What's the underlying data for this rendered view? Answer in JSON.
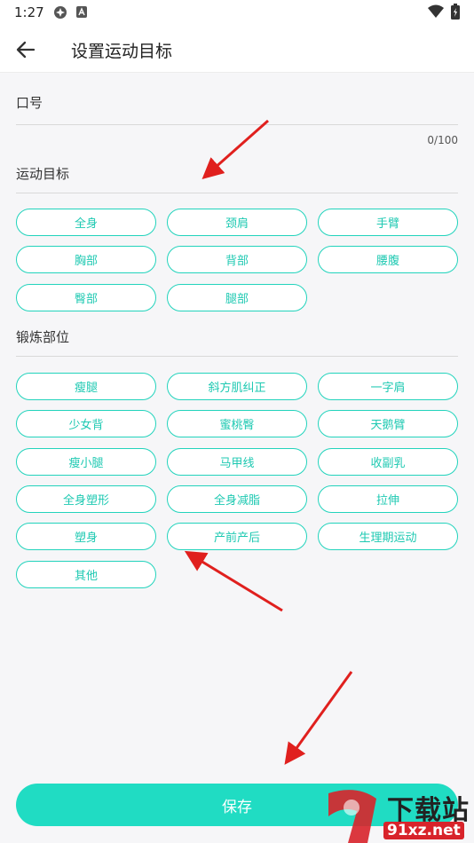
{
  "status_bar": {
    "time": "1:27"
  },
  "header": {
    "title": "设置运动目标"
  },
  "slogan": {
    "label": "口号",
    "value": "",
    "counter": "0/100"
  },
  "goals": {
    "label": "运动目标",
    "items": [
      "全身",
      "颈肩",
      "手臂",
      "胸部",
      "背部",
      "腰腹",
      "臀部",
      "腿部"
    ]
  },
  "body_parts": {
    "label": "锻炼部位",
    "items": [
      "瘦腿",
      "斜方肌纠正",
      "一字肩",
      "少女背",
      "蜜桃臀",
      "天鹅臂",
      "瘦小腿",
      "马甲线",
      "收副乳",
      "全身塑形",
      "全身减脂",
      "拉伸",
      "塑身",
      "产前产后",
      "生理期运动",
      "其他"
    ]
  },
  "save": {
    "label": "保存"
  },
  "watermark": {
    "top": "下载站",
    "bottom": "91xz.net"
  },
  "colors": {
    "accent": "#22d3bc",
    "save_bg": "#20dcc3",
    "arrow": "#e0201e"
  }
}
